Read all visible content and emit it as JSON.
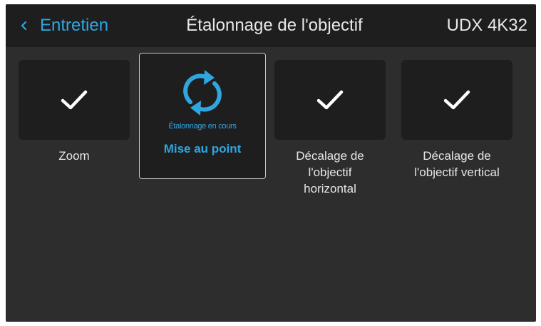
{
  "header": {
    "back_label": "Entretien",
    "title": "Étalonnage de l'objectif",
    "device": "UDX 4K32"
  },
  "tiles": [
    {
      "label": "Zoom",
      "icon": "check-icon",
      "state": "done"
    },
    {
      "label": "Mise au point",
      "icon": "sync-icon",
      "state": "in-progress",
      "status": "Étalonnage en cours"
    },
    {
      "label": "Décalage de\nl'objectif\nhorizontal",
      "icon": "check-icon",
      "state": "done"
    },
    {
      "label": "Décalage de\nl'objectif vertical",
      "icon": "check-icon",
      "state": "done"
    }
  ],
  "colors": {
    "accent": "#2fa6e0",
    "background": "#2d2d2d",
    "header_background": "#1e1e1e",
    "tile_background": "#1e1e1e",
    "text": "#e8e8e8"
  }
}
